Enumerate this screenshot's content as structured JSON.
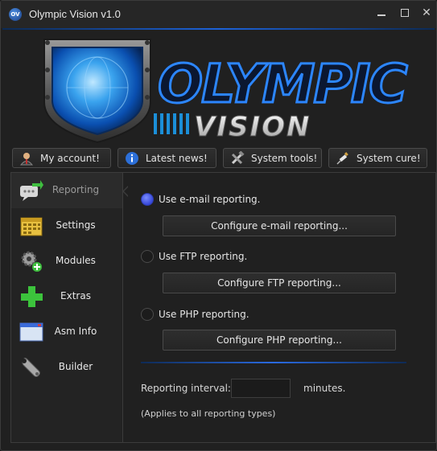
{
  "window": {
    "title": "Olympic Vision v1.0",
    "app_icon_text": "OV",
    "accent_color": "#1d62d8"
  },
  "banner": {
    "logo_word_1": "OLYMPIC",
    "logo_word_2": "VISION"
  },
  "top_buttons": [
    {
      "label": "My account!",
      "icon": "user-icon"
    },
    {
      "label": "Latest news!",
      "icon": "info-icon"
    },
    {
      "label": "System tools!",
      "icon": "tools-icon"
    },
    {
      "label": "System cure!",
      "icon": "syringe-icon"
    }
  ],
  "sidebar": {
    "items": [
      {
        "label": "Reporting",
        "icon": "chat-icon",
        "active": true
      },
      {
        "label": "Settings",
        "icon": "calendar-icon"
      },
      {
        "label": "Modules",
        "icon": "gears-icon"
      },
      {
        "label": "Extras",
        "icon": "plus-icon"
      },
      {
        "label": "Asm Info",
        "icon": "window-icon"
      },
      {
        "label": "Builder",
        "icon": "wrench-icon"
      }
    ]
  },
  "reporting": {
    "options": [
      {
        "label": "Use e-mail reporting.",
        "button": "Configure e-mail reporting...",
        "selected": true
      },
      {
        "label": "Use FTP reporting.",
        "button": "Configure FTP reporting...",
        "selected": false
      },
      {
        "label": "Use PHP reporting.",
        "button": "Configure PHP reporting...",
        "selected": false
      }
    ],
    "interval_label": "Reporting interval:",
    "interval_value": "",
    "interval_unit": "minutes.",
    "note": "(Applies to all reporting types)"
  }
}
